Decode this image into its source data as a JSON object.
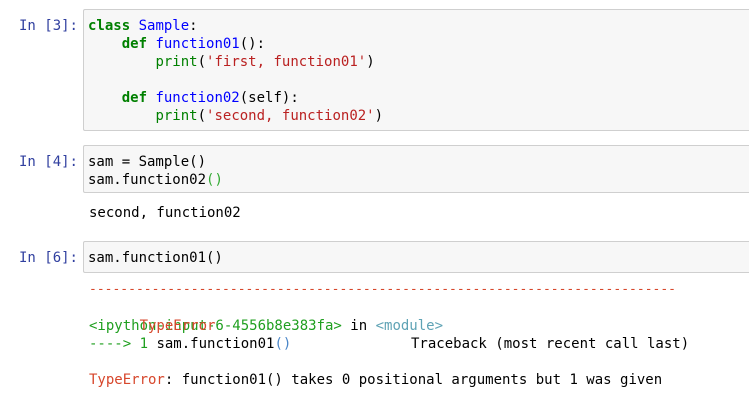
{
  "cells": [
    {
      "prompt": "In [3]:",
      "code": {
        "l1_kw": "class",
        "l1_name": "Sample",
        "l1_end": ":",
        "l2_indent": "    ",
        "l2_kw": "def",
        "l2_name": "function01",
        "l2_end": "():",
        "l3_indent": "        ",
        "l3_call": "print",
        "l3_open": "(",
        "l3_str": "'first, function01'",
        "l3_close": ")",
        "l5_indent": "    ",
        "l5_kw": "def",
        "l5_name": "function02",
        "l5_end": "(self):",
        "l6_indent": "        ",
        "l6_call": "print",
        "l6_open": "(",
        "l6_str": "'second, function02'",
        "l6_close": ")"
      }
    },
    {
      "prompt": "In [4]:",
      "code": {
        "l1": "sam = Sample()",
        "l2_a": "sam.function02",
        "l2_b": "()"
      },
      "output": "second, function02"
    },
    {
      "prompt": "In [6]:",
      "code": {
        "l1": "sam.function01()"
      },
      "traceback": {
        "separator": "---------------------------------------------------------------------------",
        "err_name": "TypeError",
        "tb_header": "Traceback (most recent call last)",
        "input_ref": "<ipython-input-6-4556b8e383fa>",
        "in_word": " in ",
        "module_ref": "<module>",
        "arrow": "----> 1 ",
        "arrow_code_a": "sam.function01",
        "arrow_code_b": "()",
        "final_err_name": "TypeError",
        "final_msg": ": function01() takes 0 positional arguments but 1 was given"
      }
    }
  ]
}
